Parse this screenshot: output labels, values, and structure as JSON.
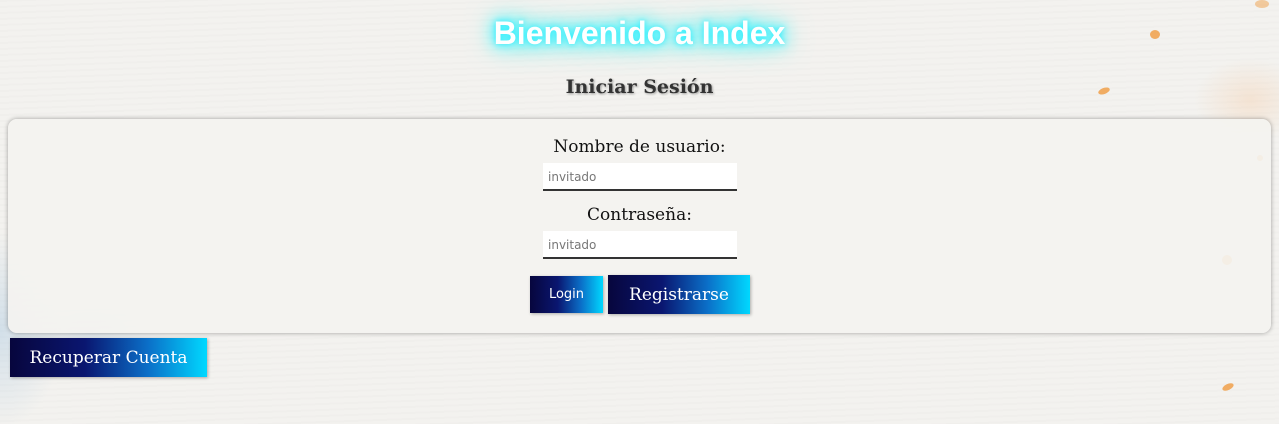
{
  "header": {
    "title": "Bienvenido a Index",
    "subtitle": "Iniciar Sesión"
  },
  "form": {
    "username_label": "Nombre de usuario:",
    "username_placeholder": "invitado",
    "password_label": "Contraseña:",
    "password_placeholder": "invitado",
    "login_label": "Login",
    "register_label": "Registrarse"
  },
  "recover_label": "Recuperar Cuenta",
  "colors": {
    "title_glow": "#27f0ff",
    "button_gradient_start": "#07063d",
    "button_gradient_end": "#00d8ff",
    "paint_splash": "#f0a04a"
  }
}
